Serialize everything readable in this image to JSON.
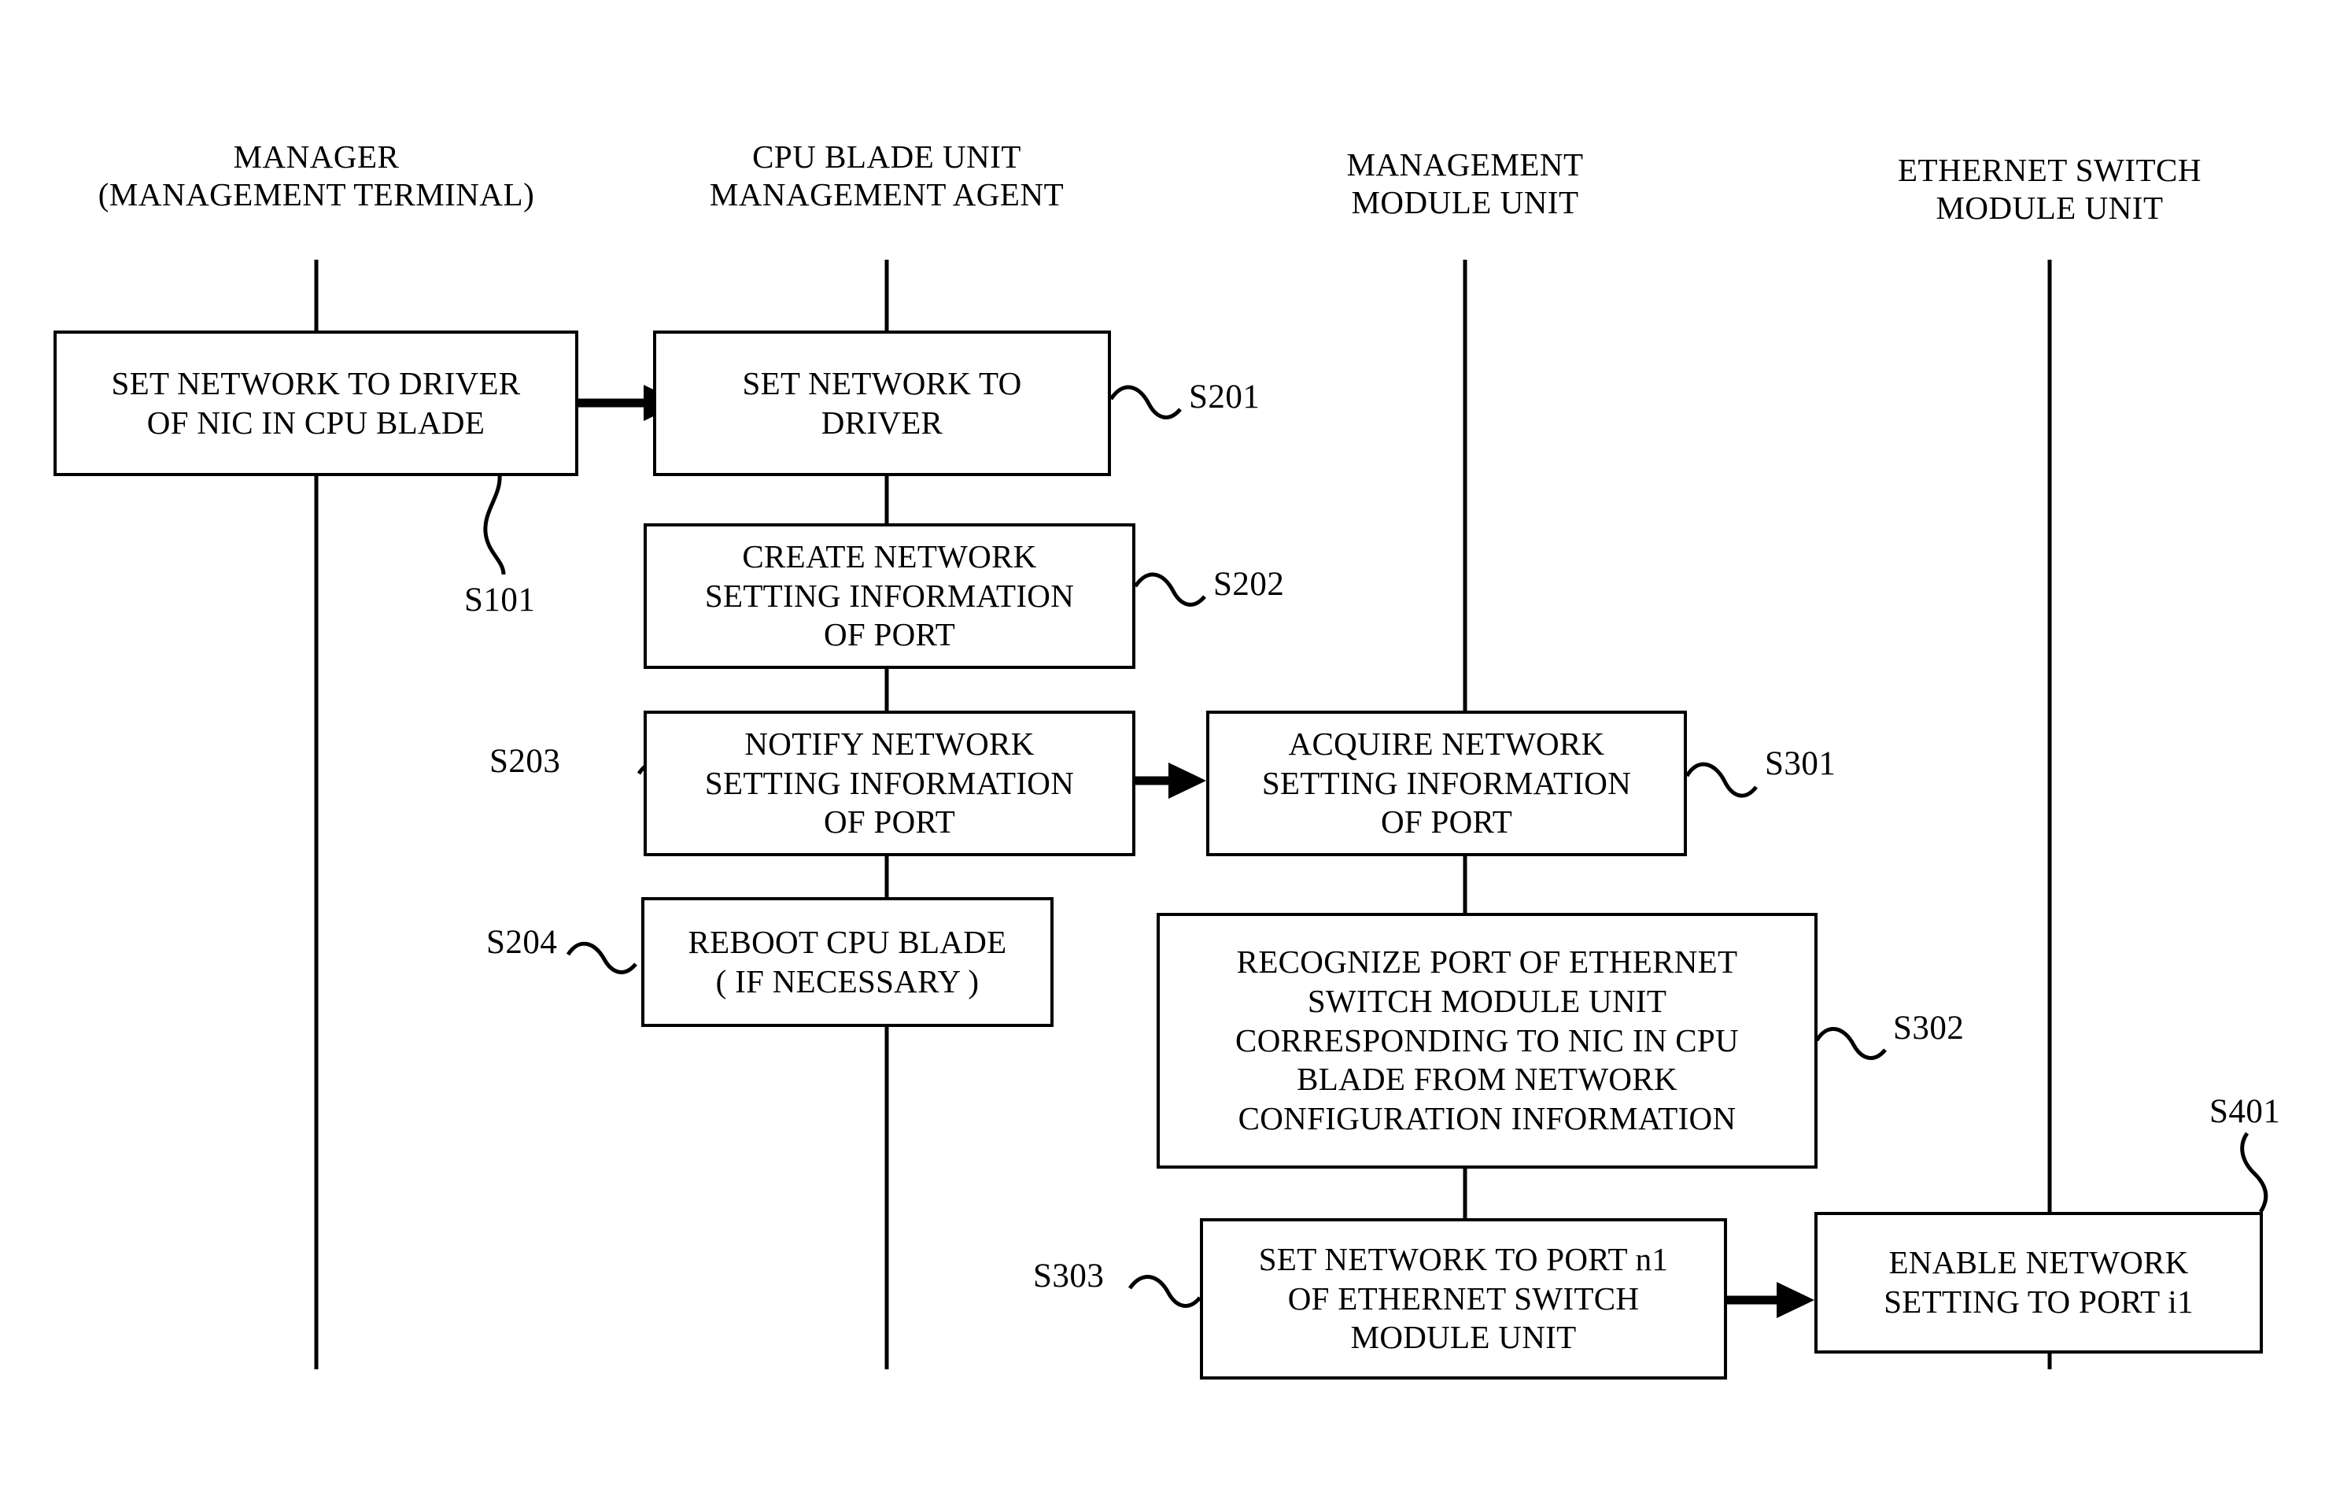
{
  "figure": {
    "type": "sequence-flow-diagram",
    "background": "#ffffff",
    "stroke": "#000000"
  },
  "lanes": [
    {
      "id": "manager",
      "line1": "MANAGER",
      "line2": "(MANAGEMENT TERMINAL)"
    },
    {
      "id": "cpu-blade-agent",
      "line1": "CPU BLADE UNIT",
      "line2": "MANAGEMENT AGENT"
    },
    {
      "id": "management-module",
      "line1": "MANAGEMENT",
      "line2": "MODULE UNIT"
    },
    {
      "id": "ethernet-switch",
      "line1": "ETHERNET SWITCH",
      "line2": "MODULE UNIT"
    }
  ],
  "nodes": [
    {
      "id": "s101",
      "lane": "manager",
      "line1": "SET NETWORK TO DRIVER",
      "line2": "OF NIC IN CPU BLADE",
      "line3": "",
      "line4": "",
      "line5": ""
    },
    {
      "id": "s201",
      "lane": "cpu-blade-agent",
      "line1": "SET NETWORK TO",
      "line2": "DRIVER",
      "line3": "",
      "line4": "",
      "line5": ""
    },
    {
      "id": "s202",
      "lane": "cpu-blade-agent",
      "line1": "CREATE NETWORK",
      "line2": "SETTING INFORMATION",
      "line3": "OF PORT",
      "line4": "",
      "line5": ""
    },
    {
      "id": "s203",
      "lane": "cpu-blade-agent",
      "line1": "NOTIFY NETWORK",
      "line2": "SETTING INFORMATION",
      "line3": "OF PORT",
      "line4": "",
      "line5": ""
    },
    {
      "id": "s204",
      "lane": "cpu-blade-agent",
      "line1": "REBOOT CPU BLADE",
      "line2": "( IF NECESSARY )",
      "line3": "",
      "line4": "",
      "line5": ""
    },
    {
      "id": "s301",
      "lane": "management-module",
      "line1": "ACQUIRE NETWORK",
      "line2": "SETTING INFORMATION",
      "line3": "OF PORT",
      "line4": "",
      "line5": ""
    },
    {
      "id": "s302",
      "lane": "management-module",
      "line1": "RECOGNIZE PORT OF ETHERNET",
      "line2": "SWITCH MODULE UNIT",
      "line3": "CORRESPONDING TO NIC IN CPU",
      "line4": "BLADE FROM NETWORK",
      "line5": "CONFIGURATION INFORMATION"
    },
    {
      "id": "s303",
      "lane": "management-module",
      "line1": "SET NETWORK TO PORT n1",
      "line2": "OF ETHERNET SWITCH",
      "line3": "MODULE UNIT",
      "line4": "",
      "line5": ""
    },
    {
      "id": "s401",
      "lane": "ethernet-switch",
      "line1": "ENABLE NETWORK",
      "line2": "SETTING TO PORT i1",
      "line3": "",
      "line4": "",
      "line5": ""
    }
  ],
  "step_labels": {
    "s101": "S101",
    "s201": "S201",
    "s202": "S202",
    "s203": "S203",
    "s204": "S204",
    "s301": "S301",
    "s302": "S302",
    "s303": "S303",
    "s401": "S401"
  }
}
